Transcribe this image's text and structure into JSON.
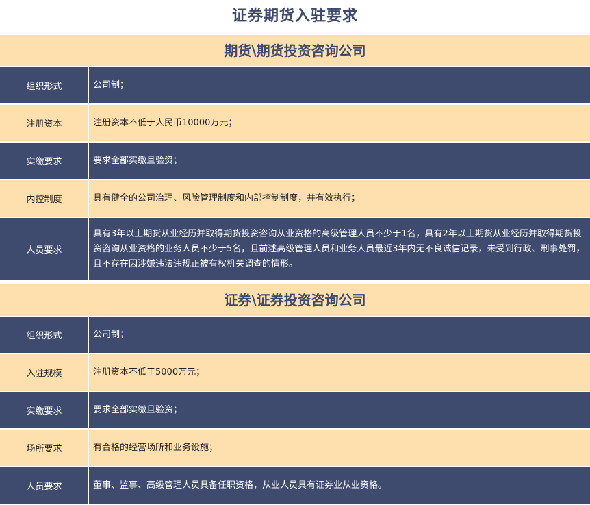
{
  "title": "证券期货入驻要求",
  "sections": [
    {
      "header": "期货\\期货投资咨询公司",
      "rows": [
        {
          "label": "组织形式",
          "value": "公司制；"
        },
        {
          "label": "注册资本",
          "value": "注册资本不低于人民币10000万元；"
        },
        {
          "label": "实缴要求",
          "value": "要求全部实缴且验资；"
        },
        {
          "label": "内控制度",
          "value": "具有健全的公司治理、风险管理制度和内部控制制度，并有效执行；"
        },
        {
          "label": "人员要求",
          "value": "具有3年以上期货从业经历并取得期货投资咨询从业资格的高级管理人员不少于1名，具有2年以上期货从业经历并取得期货投资咨询从业资格的业务人员不少于5名，且前述高级管理人员和业务人员最近3年内无不良诚信记录，未受到行政、刑事处罚，且不存在因涉嫌违法违规正被有权机关调查的情形。"
        }
      ]
    },
    {
      "header": "证券\\证券投资咨询公司",
      "rows": [
        {
          "label": "组织形式",
          "value": "公司制；"
        },
        {
          "label": "入驻规模",
          "value": "注册资本不低于5000万元；"
        },
        {
          "label": "实缴要求",
          "value": "要求全部实缴且验资；"
        },
        {
          "label": "场所要求",
          "value": "有合格的经营场所和业务设施；"
        },
        {
          "label": "人员要求",
          "value": "董事、监事、高级管理人员具备任职资格，从业人员具有证券业从业资格。"
        }
      ]
    }
  ],
  "colors": {
    "dark_row": "#3e4b6e",
    "light_row": "#fde0ae",
    "title_text": "#3d4a6d"
  }
}
